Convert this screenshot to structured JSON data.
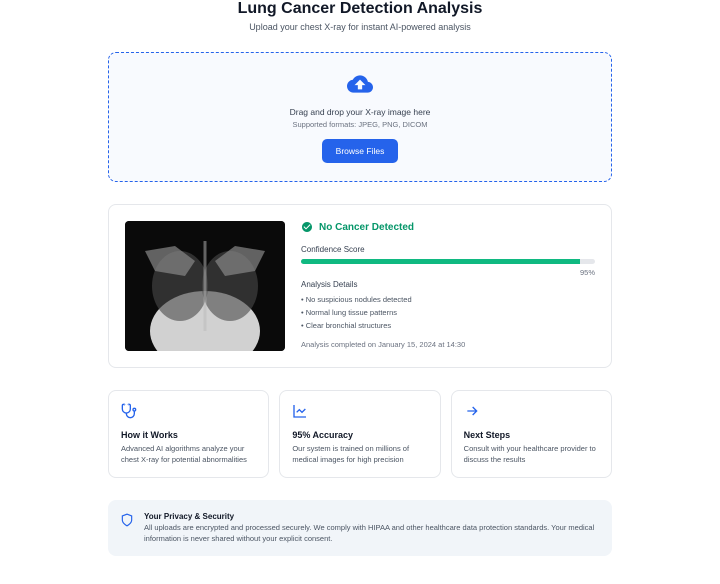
{
  "header": {
    "title": "Lung Cancer Detection Analysis",
    "subtitle": "Upload your chest X-ray for instant AI-powered analysis"
  },
  "upload": {
    "drop_text": "Drag and drop your X-ray image here",
    "formats": "Supported formats: JPEG, PNG, DICOM",
    "browse_label": "Browse Files"
  },
  "result": {
    "title": "No Cancer Detected",
    "confidence_label": "Confidence Score",
    "confidence_percent": "95%",
    "details_label": "Analysis Details",
    "details": [
      "• No suspicious nodules detected",
      "• Normal lung tissue patterns",
      "• Clear bronchial structures"
    ],
    "timestamp": "Analysis completed on January 15, 2024 at 14:30"
  },
  "info_cards": [
    {
      "title": "How it Works",
      "desc": "Advanced AI algorithms analyze your chest X-ray for potential abnormalities"
    },
    {
      "title": "95% Accuracy",
      "desc": "Our system is trained on millions of medical images for high precision"
    },
    {
      "title": "Next Steps",
      "desc": "Consult with your healthcare provider to discuss the results"
    }
  ],
  "privacy": {
    "title": "Your Privacy & Security",
    "desc": "All uploads are encrypted and processed securely. We comply with HIPAA and other healthcare data protection standards. Your medical information is never shared without your explicit consent."
  }
}
